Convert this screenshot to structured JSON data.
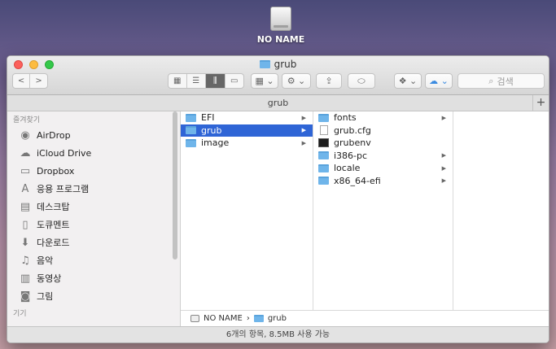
{
  "desktop": {
    "drive_label": "NO NAME"
  },
  "window": {
    "title": "grub",
    "path_title": "grub",
    "search_placeholder": "검색",
    "status": "6개의 항목, 8.5MB 사용 가능"
  },
  "toolbar": {
    "back": "<",
    "forward": ">",
    "view_icons": "▦",
    "view_list": "☰",
    "view_columns": "⫼",
    "view_gallery": "▭",
    "arrange": "▦ ⌄",
    "action": "⚙ ⌄",
    "share": "⇪",
    "tag": "⬭",
    "dropbox": "❖ ⌄",
    "icloud": "☁ ⌄",
    "plus": "+"
  },
  "sidebar": {
    "favorites_header": "즐겨찾기",
    "devices_header": "기기",
    "items": [
      {
        "label": "AirDrop",
        "icon": "airdrop-icon",
        "glyph": "◉"
      },
      {
        "label": "iCloud Drive",
        "icon": "icloud-icon",
        "glyph": "☁"
      },
      {
        "label": "Dropbox",
        "icon": "folder-icon",
        "glyph": "▭"
      },
      {
        "label": "응용 프로그램",
        "icon": "applications-icon",
        "glyph": "A"
      },
      {
        "label": "데스크탑",
        "icon": "desktop-icon",
        "glyph": "▤"
      },
      {
        "label": "도큐멘트",
        "icon": "documents-icon",
        "glyph": "▯"
      },
      {
        "label": "다운로드",
        "icon": "download-icon",
        "glyph": "⬇"
      },
      {
        "label": "음악",
        "icon": "music-icon",
        "glyph": "♫"
      },
      {
        "label": "동영상",
        "icon": "movies-icon",
        "glyph": "▥"
      },
      {
        "label": "그림",
        "icon": "pictures-icon",
        "glyph": "◙"
      }
    ]
  },
  "columns": {
    "col1": [
      {
        "name": "EFI",
        "type": "folder",
        "selected": false
      },
      {
        "name": "grub",
        "type": "folder",
        "selected": true
      },
      {
        "name": "image",
        "type": "folder",
        "selected": false
      }
    ],
    "col2": [
      {
        "name": "fonts",
        "type": "folder"
      },
      {
        "name": "grub.cfg",
        "type": "file"
      },
      {
        "name": "grubenv",
        "type": "exec"
      },
      {
        "name": "i386-pc",
        "type": "folder"
      },
      {
        "name": "locale",
        "type": "folder"
      },
      {
        "name": "x86_64-efi",
        "type": "folder"
      }
    ]
  },
  "pathbar": {
    "drive": "NO NAME",
    "folder": "grub",
    "separator": "›"
  }
}
